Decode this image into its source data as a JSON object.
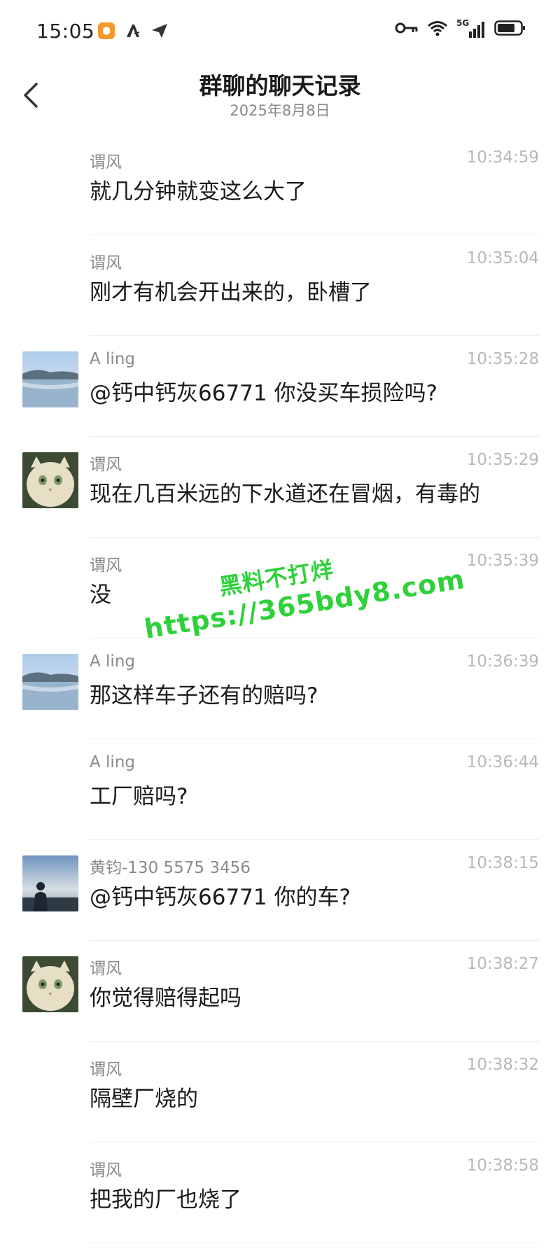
{
  "status_bar": {
    "time": "15:05",
    "network": "5G",
    "app_icons": [
      "app-badge-icon",
      "a-icon",
      "send-icon"
    ]
  },
  "header": {
    "title": "群聊的聊天记录",
    "date": "2025年8月8日"
  },
  "messages": [
    {
      "sender": "谓风",
      "time": "10:34:59",
      "text": "就几分钟就变这么大了",
      "avatar": null
    },
    {
      "sender": "谓风",
      "time": "10:35:04",
      "text": "刚才有机会开出来的，卧槽了",
      "avatar": null
    },
    {
      "sender": "A ling",
      "time": "10:35:28",
      "text": "@钙中钙灰66771 你没买车损险吗?",
      "avatar": "lake"
    },
    {
      "sender": "谓风",
      "time": "10:35:29",
      "text": "现在几百米远的下水道还在冒烟，有毒的",
      "avatar": "cat"
    },
    {
      "sender": "谓风",
      "time": "10:35:39",
      "text": "没",
      "avatar": null
    },
    {
      "sender": "A ling",
      "time": "10:36:39",
      "text": "那这样车子还有的赔吗?",
      "avatar": "lake"
    },
    {
      "sender": "A ling",
      "time": "10:36:44",
      "text": "工厂赔吗?",
      "avatar": null
    },
    {
      "sender": "黄钧-130 5575 3456",
      "time": "10:38:15",
      "text": "@钙中钙灰66771 你的车?",
      "avatar": "sea"
    },
    {
      "sender": "谓风",
      "time": "10:38:27",
      "text": "你觉得赔得起吗",
      "avatar": "cat"
    },
    {
      "sender": "谓风",
      "time": "10:38:32",
      "text": "隔壁厂烧的",
      "avatar": null
    },
    {
      "sender": "谓风",
      "time": "10:38:58",
      "text": "把我的厂也烧了",
      "avatar": null
    }
  ],
  "watermark": {
    "line1": "黑料不打烊",
    "line2": "https://365bdy8.com"
  },
  "colors": {
    "watermark": "#2ed13a",
    "sender": "#8a8a8a",
    "time": "#b8b8b8"
  }
}
